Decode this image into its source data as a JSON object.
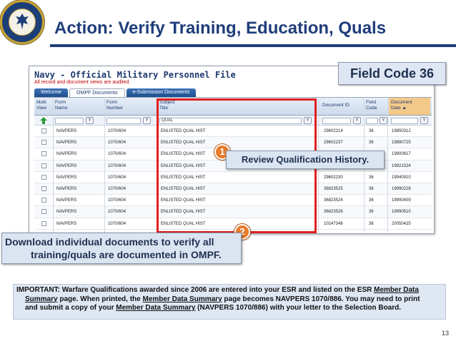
{
  "slide": {
    "title": "Action: Verify Training, Education, Quals",
    "page_number": "13",
    "accent_color": "#1f3d7a"
  },
  "screenshot": {
    "title": "Navy - Official Military Personnel File",
    "subtitle": "All record and document views are audited.",
    "tabs": [
      {
        "label": "Welcome",
        "active": false
      },
      {
        "label": "OMPF Documents",
        "active": true
      },
      {
        "label": "e-Submission Documents",
        "active": false
      }
    ],
    "columns": [
      {
        "l1": "Multi",
        "l2": "View"
      },
      {
        "l1": "Form",
        "l2": "Name"
      },
      {
        "l1": "Form",
        "l2": "Number"
      },
      {
        "l1": "Subject",
        "l2": "Title"
      },
      {
        "l1": "Document ID",
        "l2": ""
      },
      {
        "l1": "Field",
        "l2": "Code"
      },
      {
        "l1": "Document",
        "l2": "Date ▲"
      }
    ],
    "filter": {
      "subject_value": "QUAL",
      "filter_icon": "filter-icon"
    },
    "rows": [
      {
        "form_name": "NAVPERS",
        "form_number": "1070/604",
        "subject": "ENLISTED QUAL HIST",
        "doc_id": "29602214",
        "field_code": "36",
        "date": "19850312"
      },
      {
        "form_name": "NAVPERS",
        "form_number": "1070/604",
        "subject": "ENLISTED QUAL HIST",
        "doc_id": "29602237",
        "field_code": "36",
        "date": "19890725"
      },
      {
        "form_name": "NAVPERS",
        "form_number": "1070/604",
        "subject": "ENLISTED QUAL HIST",
        "doc_id": "",
        "field_code": "",
        "date": "19900617"
      },
      {
        "form_name": "NAVPERS",
        "form_number": "1070/604",
        "subject": "ENLISTED QUAL HIST",
        "doc_id": "",
        "field_code": "",
        "date": "19921024"
      },
      {
        "form_name": "NAVPERS",
        "form_number": "1070/604",
        "subject": "ENLISTED QUAL HIST",
        "doc_id": "29602230",
        "field_code": "36",
        "date": "19940910"
      },
      {
        "form_name": "NAVPERS",
        "form_number": "1070/604",
        "subject": "ENLISTED QUAL HIST",
        "doc_id": "36823525",
        "field_code": "36",
        "date": "19990228"
      },
      {
        "form_name": "NAVPERS",
        "form_number": "1070/604",
        "subject": "ENLISTED QUAL HIST",
        "doc_id": "36823524",
        "field_code": "36",
        "date": "19990409"
      },
      {
        "form_name": "NAVPERS",
        "form_number": "1070/604",
        "subject": "ENLISTED QUAL HIST",
        "doc_id": "36823526",
        "field_code": "36",
        "date": "19990510"
      },
      {
        "form_name": "NAVPERS",
        "form_number": "1070/604",
        "subject": "ENLISTED QUAL HIST",
        "doc_id": "10247348",
        "field_code": "36",
        "date": "20050425"
      }
    ]
  },
  "field_code_label": "Field Code 36",
  "callouts": {
    "one": {
      "number": "1",
      "text": "Review Qualification History."
    },
    "two": {
      "number": "2",
      "line1": "Download individual documents to verify all",
      "line2": "training/quals are documented in OMPF."
    }
  },
  "note": {
    "p1": "IMPORTANT: Warfare Qualifications awarded since 2006 are entered into your ESR and listed on the ESR ",
    "link1": "Member Data",
    "p2": "Summary",
    "p3": " page. When printed, the ",
    "link2": "Member Data Summary",
    "p4": " page becomes NAVPERS 1070/886. You may need to print",
    "p5": "and submit a copy of your ",
    "link3": "Member Data Summary",
    "p6": " (NAVPERS 1070/886) with your letter to the Selection Board."
  }
}
